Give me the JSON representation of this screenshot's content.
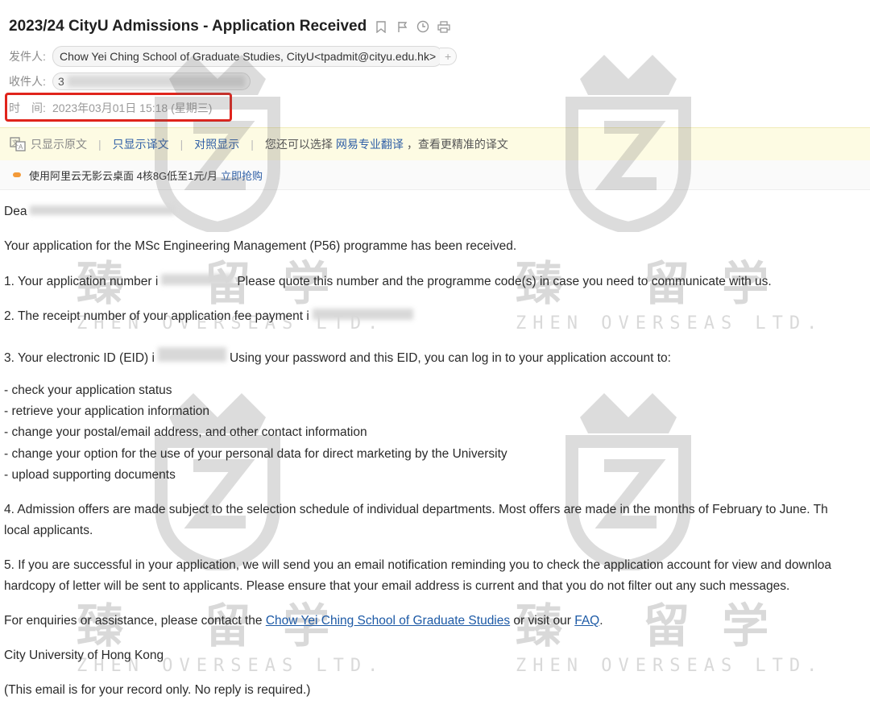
{
  "email": {
    "subject": "2023/24 CityU Admissions - Application Received",
    "from_label": "发件人:",
    "from_value": "Chow Yei Ching School of Graduate Studies, CityU<tpadmit@cityu.edu.hk>",
    "add_symbol": "+",
    "to_label": "收件人:",
    "to_value_visible": "3",
    "time_label": "时　间:",
    "time_value": "2023年03月01日 15:18 (星期三)"
  },
  "translate_bar": {
    "original_only": "只显示原文",
    "translation_only": "只显示译文",
    "side_by_side": "对照显示",
    "hint_prefix": "您还可以选择",
    "service": "网易专业翻译",
    "hint_suffix": "，查看更精准的译文"
  },
  "ad_bar": {
    "text": "使用阿里云无影云桌面 4核8G低至1元/月",
    "cta": "立即抢购"
  },
  "body": {
    "greeting": "Dea",
    "line_received": "Your application for the MSc Engineering Management (P56) programme has been received.",
    "item1_prefix": "1. Your application number i",
    "item1_suffix": "Please quote this number and the programme code(s) in case you need to communicate with us.",
    "item2": "2. The receipt number of your application fee payment i",
    "item3_prefix": "3. Your electronic ID (EID) i",
    "item3_suffix": "Using your password and this EID, you can log in to your application account to:",
    "bullets": [
      "- check your application status",
      "- retrieve your application information",
      "- change your postal/email address, and other contact information",
      "- change your option for the use of your personal data for direct marketing by the University",
      "- upload supporting documents"
    ],
    "item4_line1": "4. Admission offers are made subject to the selection schedule of individual departments. Most offers are made in the months of February to June. Th",
    "item4_line2": "local applicants.",
    "item5_line1": "5. If you are successful in your application, we will send you an email notification reminding you to check the application account for view and downloa",
    "item5_line2": "hardcopy of letter will be sent to applicants. Please ensure that your email address is current and that you do not filter out any such messages.",
    "enquiry_prefix": "For enquiries or assistance, please contact the ",
    "enquiry_link": "Chow Yei Ching School of Graduate Studies",
    "enquiry_mid": " or visit our ",
    "faq_link": "FAQ",
    "enquiry_end": ".",
    "signature": "City University of Hong Kong",
    "footer": "(This email is for your record only. No reply is required.)"
  },
  "watermark": {
    "cn": "臻 留学",
    "en": "ZHEN OVERSEAS LTD."
  },
  "colors": {
    "red_highlight": "#e0241c",
    "link_blue": "#1d5aa6",
    "translate_bg": "#fdfbe3"
  }
}
